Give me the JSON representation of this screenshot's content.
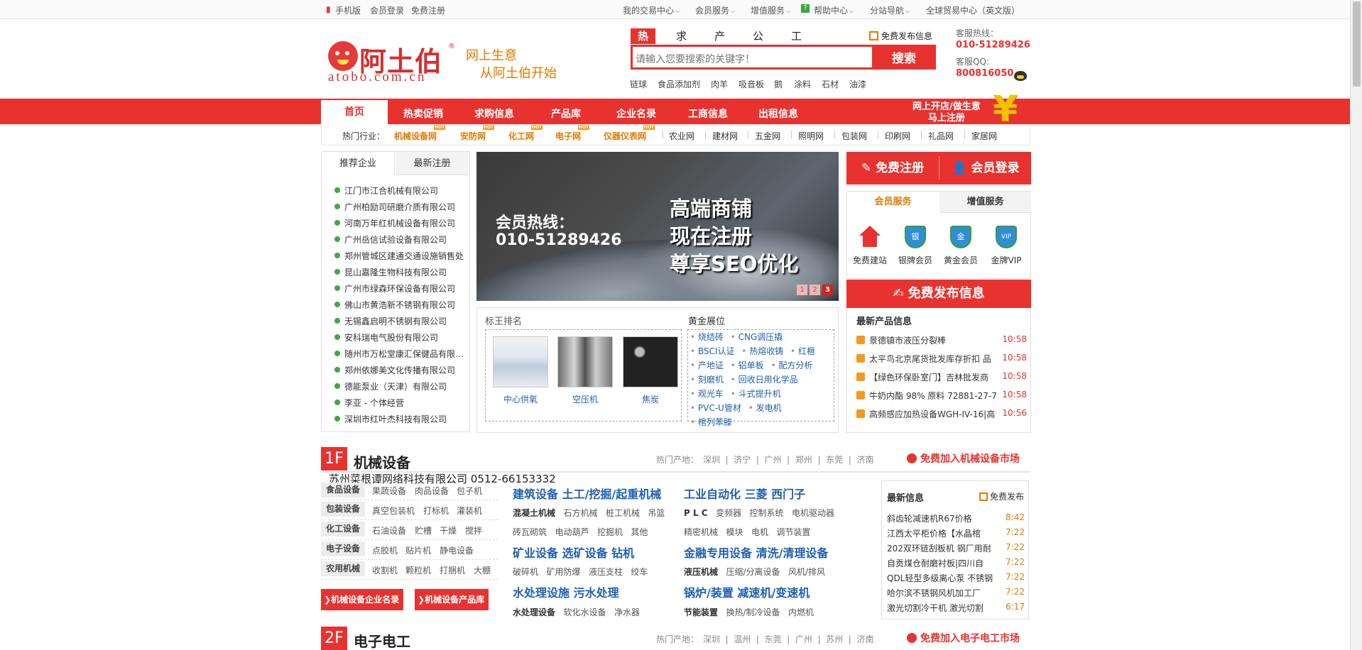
{
  "topbar": {
    "left": [
      "手机版",
      "会员登录",
      "免费注册"
    ],
    "right": [
      "我的交易中心",
      "会员服务",
      "增值服务",
      "帮助中心",
      "分站导航",
      "全球贸易中心（英文版）"
    ]
  },
  "header": {
    "logo_text": "阿土伯",
    "logo_url": "atobo.com.cn",
    "slogan_line1": "网上生意",
    "slogan_line2": "从阿土伯开始",
    "search_tabs": [
      "热卖",
      "求购",
      "产品",
      "公司",
      "工商"
    ],
    "search_placeholder": "请输入您要搜索的关键字！",
    "search_button": "搜索",
    "publish_link": "免费发布信息",
    "hot_keywords": [
      "链球",
      "食品添加剂",
      "肉羊",
      "吸音板",
      "鹅",
      "涂料",
      "石材",
      "油漆"
    ],
    "hotline_label": "客服热线：",
    "hotline": "010-51289426",
    "qq_label": "客服QQ:",
    "qq": "800816050"
  },
  "nav": {
    "items": [
      "首页",
      "热卖促销",
      "求购信息",
      "产品库",
      "企业名录",
      "工商信息",
      "出租信息"
    ],
    "open_shop_line1": "网上开店/做生意",
    "open_shop_line2": "马上注册",
    "industry_label": "热门行业：",
    "hot_industries": [
      "机械设备网",
      "安防网",
      "化工网",
      "电子网",
      "仪器仪表网"
    ],
    "hot_badge": "HOT",
    "industries": [
      "农业网",
      "建材网",
      "五金网",
      "照明网",
      "包装网",
      "印刷网",
      "礼品网",
      "家居网"
    ]
  },
  "left_box": {
    "tabs": [
      "推荐企业",
      "最新注册"
    ],
    "companies": [
      "江门市江合机械有限公司",
      "广州柏励司研磨介质有限公司",
      "河南万年红机械设备有限公司",
      "广州岳信试验设备有限公司",
      "郑州管城区建通交通设施销售处",
      "昆山嘉隆生物科技有限公司",
      "广州市绿森环保设备有限公司",
      "佛山市黄浩新不锈钢有限公司",
      "无锡鑫启明不锈钢有限公司",
      "安科瑞电气股份有限公司",
      "随州市万松堂康汇保健品有限公...",
      "郑州依娜美文化传播有限公司",
      "德能泵业（天津）有限公司",
      "李亚 - 个体经营",
      "深圳市红叶杰科技有限公司"
    ]
  },
  "banner": {
    "hotline_label": "会员热线：",
    "hotline": "010-51289426",
    "big_lines": [
      "高端商铺",
      "现在注册",
      "尊享SEO优化"
    ],
    "pages": [
      "1",
      "2",
      "3"
    ]
  },
  "ranking": {
    "title_left": "标王排名",
    "title_right": "黄金展位",
    "products": [
      "中心供氧",
      "空压机",
      "焦炭"
    ],
    "gold_items": [
      "烧结砖",
      "CNG调压撬",
      "BSCI认证",
      "热熔收铸",
      "红榧",
      "产地证",
      "铝单板",
      "配方分析",
      "刻磨机",
      "回收日用化学品",
      "观光车",
      "斗式提升机",
      "PVC-U管材",
      "发电机",
      "棺列苯滕"
    ]
  },
  "right_col": {
    "register": "免费注册",
    "login": "会员登录",
    "service_tabs": [
      "会员服务",
      "增值服务"
    ],
    "services": [
      {
        "label": "免费建站",
        "badge": ""
      },
      {
        "label": "银牌会员",
        "badge": "银"
      },
      {
        "label": "黄金会员",
        "badge": "金"
      },
      {
        "label": "金牌VIP",
        "badge": "VIP"
      }
    ],
    "free_publish": "免费发布信息",
    "latest_title": "最新产品信息",
    "latest": [
      {
        "title": "景德镇市液压分裂棒",
        "time": "10:58"
      },
      {
        "title": "太平鸟北京尾货批发库存折扣 品",
        "time": "10:58"
      },
      {
        "title": "【绿色环保卧室门】吉林批发商",
        "time": "10:58"
      },
      {
        "title": "牛奶内酯 98% 原料 72881-27-7",
        "time": "10:58"
      },
      {
        "title": "高频感应加热设备WGH-IV-16|高",
        "time": "10:56"
      }
    ]
  },
  "floor1": {
    "num": "1F",
    "title": "机械设备",
    "hot_label": "热门产地：",
    "areas": [
      "深圳",
      "济宁",
      "广州",
      "郑州",
      "东莞",
      "济南"
    ],
    "join": "免费加入机械设备市场",
    "overlay": "苏州菜根谭网络科技有限公司 0512-66153332",
    "categories": [
      {
        "tag": "食品设备",
        "items": [
          "果蔬设备",
          "肉品设备",
          "包子机"
        ]
      },
      {
        "tag": "包装设备",
        "items": [
          "真空包装机",
          "打标机",
          "灌装机"
        ]
      },
      {
        "tag": "化工设备",
        "items": [
          "石油设备",
          "贮槽",
          "干燥",
          "搅拌"
        ]
      },
      {
        "tag": "电子设备",
        "items": [
          "点胶机",
          "贴片机",
          "静电设备"
        ]
      },
      {
        "tag": "农用机械",
        "items": [
          "收割机",
          "颗粒机",
          "打捆机",
          "大棚"
        ]
      }
    ],
    "btn_companies": "机械设备企业名录",
    "btn_products": "机械设备产品库",
    "sections": {
      "s1_head": "建筑设备  土工/挖掘/起重机械",
      "s1_sub": [
        "混凝土机械",
        "石方机械",
        "桩工机械",
        "吊篮"
      ],
      "s1_sub2": [
        "砖瓦砌筑",
        "电动葫芦",
        "挖掘机",
        "其他"
      ],
      "s2_head": "工业自动化  三菱  西门子",
      "s2_sub": [
        "P L C",
        "变频器",
        "控制系统",
        "电机驱动器"
      ],
      "s2_sub2": [
        "精密机械",
        "模块",
        "电机",
        "调节装置"
      ],
      "s3_head": "矿业设备  选矿设备  钻机",
      "s3_sub": [
        "破碎机",
        "矿用防爆",
        "液压支柱",
        "绞车"
      ],
      "s4_head": "金融专用设备  清洗/清理设备",
      "s4_sub": [
        "液压机械",
        "压缩/分离设备",
        "风机/排风"
      ],
      "s5_head": "水处理设施  污水处理",
      "s5_sub": [
        "水处理设备",
        "软化水设备",
        "净水器"
      ],
      "s6_head": "锅炉/装置  减速机/变速机",
      "s6_sub": [
        "节能装置",
        "换热/制冷设备",
        "内燃机"
      ]
    },
    "news_title": "最新信息",
    "news_publish": "免费发布",
    "news": [
      {
        "title": "斜齿轮减速机R67价格",
        "time": "8:42"
      },
      {
        "title": "江西太平柜价格【水晶棺",
        "time": "7:22"
      },
      {
        "title": "202双环链刮板机 钢厂用耐",
        "time": "7:22"
      },
      {
        "title": "自贡煤仓耐磨衬板|四川自",
        "time": "7:22"
      },
      {
        "title": "QDL轻型多级离心泵 不锈钢",
        "time": "7:22"
      },
      {
        "title": "哈尔滨不锈钢风机加工厂",
        "time": "7:22"
      },
      {
        "title": "激光切割冷干机 激光切割",
        "time": "6:17"
      }
    ]
  },
  "floor2": {
    "num": "2F",
    "title": "电子电工",
    "hot_label": "热门产地：",
    "areas": [
      "深圳",
      "温州",
      "东莞",
      "广州",
      "苏州",
      "济南"
    ],
    "join": "免费加入电子电工市场"
  },
  "colors": {
    "brand_red": "#e8322f",
    "accent_orange": "#e07a00",
    "link_blue": "#1f5fb0"
  }
}
